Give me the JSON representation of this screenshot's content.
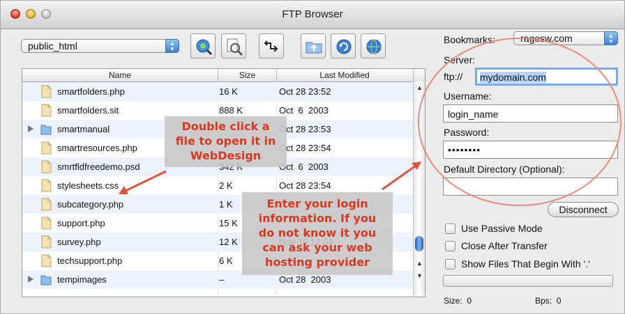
{
  "window": {
    "title": "FTP Browser"
  },
  "folder_popup": {
    "value": "public_html"
  },
  "toolbar": {
    "buttons": [
      "connect-icon",
      "info-icon",
      "sync-icon",
      "upload-icon",
      "refresh-icon",
      "web-icon"
    ]
  },
  "table": {
    "headers": {
      "name": "Name",
      "size": "Size",
      "modified": "Last Modified"
    },
    "rows": [
      {
        "name": "smartfolders.php",
        "size": "16 K",
        "modified": "Oct 28 23:52",
        "type": "file"
      },
      {
        "name": "smartfolders.sit",
        "size": "888 K",
        "modified": "Oct  6  2003",
        "type": "file"
      },
      {
        "name": "smartmanual",
        "size": "",
        "modified": "Oct 28 23:53",
        "type": "folder"
      },
      {
        "name": "smartresources.php",
        "size": "",
        "modified": "Oct 28 23:54",
        "type": "file"
      },
      {
        "name": "smrtfldfreedemo.psd",
        "size": "342 K",
        "modified": "Oct  6  2003",
        "type": "file"
      },
      {
        "name": "stylesheets.css",
        "size": "2 K",
        "modified": "Oct 28 23:54",
        "type": "file"
      },
      {
        "name": "subcategory.php",
        "size": "1 K",
        "modified": "",
        "type": "file"
      },
      {
        "name": "support.php",
        "size": "15 K",
        "modified": "",
        "type": "file"
      },
      {
        "name": "survey.php",
        "size": "12 K",
        "modified": "Nov 19 12:04",
        "type": "file"
      },
      {
        "name": "techsupport.php",
        "size": "6 K",
        "modified": "",
        "type": "file"
      },
      {
        "name": "tempimages",
        "size": "–",
        "modified": "Oct 28  2003",
        "type": "folder"
      }
    ]
  },
  "panel": {
    "bookmarks_label": "Bookmarks:",
    "bookmarks_value": "ragesw.com",
    "server_label": "Server:",
    "server_prefix": "ftp://",
    "server_value": "mydomain.com",
    "username_label": "Username:",
    "username_value": "login_name",
    "password_label": "Password:",
    "password_value": "••••••••",
    "directory_label": "Default Directory (Optional):",
    "directory_value": "",
    "disconnect_label": "Disconnect",
    "checkboxes": [
      "Use Passive Mode",
      "Close After Transfer",
      "Show Files That Begin With '.'"
    ],
    "size_label": "Size:",
    "size_value": "0",
    "bps_label": "Bps:",
    "bps_value": "0"
  },
  "callouts": {
    "double_click": [
      "Double click a",
      "file to open it in",
      "WebDesign"
    ],
    "login": [
      "Enter your login",
      "information. If you",
      "do not know it you",
      "can ask your web",
      "hosting provider"
    ]
  },
  "colors": {
    "callout_text": "#d6391f",
    "callout_bg": "#c8c8c8",
    "annotation_red": "#e0533f",
    "selection_blue": "#3a82d6",
    "row_stripe": "#edf3fe"
  }
}
